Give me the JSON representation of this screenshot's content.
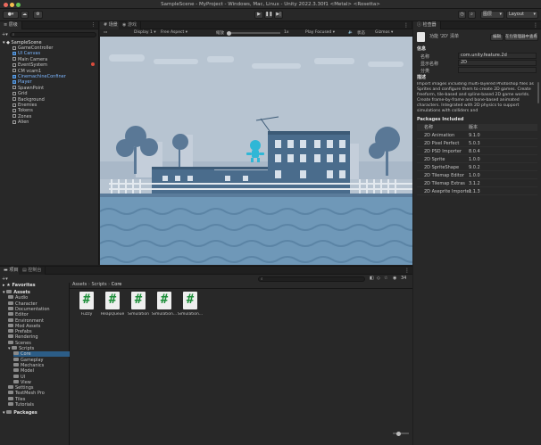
{
  "window": {
    "title": "SampleScene - MyProject - Windows, Mac, Linux - Unity 2022.3.30f1 <Metal> <Rosetta>"
  },
  "toolbar": {
    "layers_label": "图层",
    "layout_label": "Layout"
  },
  "hierarchy": {
    "tab_label": "层级",
    "search_placeholder": "All",
    "scene_name": "SampleScene",
    "items": [
      {
        "label": "GameController"
      },
      {
        "label": "UI Canvas"
      },
      {
        "label": "Main Camera"
      },
      {
        "label": "EventSystem"
      },
      {
        "label": "CM vcam1"
      },
      {
        "label": "CinemachineConfiner"
      },
      {
        "label": "Player"
      },
      {
        "label": "SpawnPoint"
      },
      {
        "label": "Grid"
      },
      {
        "label": "Background"
      },
      {
        "label": "Enemies"
      },
      {
        "label": "Tokens"
      },
      {
        "label": "Zones"
      },
      {
        "label": "Alien"
      }
    ]
  },
  "scene": {
    "tabs": [
      "场景",
      "游戏"
    ],
    "display": "Display 1",
    "aspect": "Free Aspect",
    "scale_label": "缩放",
    "scale_value": "1x",
    "play_mode": "Play Focused",
    "stats": "状态",
    "gizmos": "Gizmos"
  },
  "inspector": {
    "tab_label": "检查器",
    "header": "功能 '2D' 清单",
    "btn_edit": "编辑",
    "btn_open": "在包管理器中查看",
    "info_title": "信息",
    "fields": [
      {
        "label": "名称",
        "value": "com.unity.feature.2d"
      },
      {
        "label": "显示名称",
        "value": "2D"
      },
      {
        "label": "分类",
        "value": ""
      }
    ],
    "desc_title": "描述",
    "description": "Import images including multi-layered Photoshop files as Sprites and configure them to create 2D games. Create freeform, tile-based and spline-based 2D game worlds. Create frame-by-frame and bone-based animated characters. Integrated with 2D physics to support simulations with colliders and",
    "packages_title": "Packages Included",
    "col_name": "名称",
    "col_version": "版本",
    "packages": [
      {
        "name": "2D Animation",
        "version": "9.1.0"
      },
      {
        "name": "2D Pixel Perfect",
        "version": "5.0.3"
      },
      {
        "name": "2D PSD Importer",
        "version": "8.0.4"
      },
      {
        "name": "2D Sprite",
        "version": "1.0.0"
      },
      {
        "name": "2D SpriteShape",
        "version": "9.0.2"
      },
      {
        "name": "2D Tilemap Editor",
        "version": "1.0.0"
      },
      {
        "name": "2D Tilemap Extras",
        "version": "3.1.2"
      },
      {
        "name": "2D Aseprite Importer",
        "version": "1.1.3"
      }
    ]
  },
  "project": {
    "tabs": [
      "项目",
      "控制台"
    ],
    "favorites": "Favorites",
    "breadcrumb": [
      "Assets",
      "Scripts",
      "Core"
    ],
    "count": "34",
    "tree": [
      {
        "label": "Assets",
        "depth": 0
      },
      {
        "label": "Audio",
        "depth": 1
      },
      {
        "label": "Character",
        "depth": 1
      },
      {
        "label": "Documentation",
        "depth": 1
      },
      {
        "label": "Editor",
        "depth": 1
      },
      {
        "label": "Environment",
        "depth": 1
      },
      {
        "label": "Mod Assets",
        "depth": 1
      },
      {
        "label": "Prefabs",
        "depth": 1
      },
      {
        "label": "Rendering",
        "depth": 1
      },
      {
        "label": "Scenes",
        "depth": 1
      },
      {
        "label": "Scripts",
        "depth": 1
      },
      {
        "label": "Core",
        "depth": 2
      },
      {
        "label": "Gameplay",
        "depth": 2
      },
      {
        "label": "Mechanics",
        "depth": 2
      },
      {
        "label": "Model",
        "depth": 2
      },
      {
        "label": "UI",
        "depth": 2
      },
      {
        "label": "View",
        "depth": 2
      },
      {
        "label": "Settings",
        "depth": 1
      },
      {
        "label": "TextMesh Pro",
        "depth": 1
      },
      {
        "label": "Tiles",
        "depth": 1
      },
      {
        "label": "Tutorials",
        "depth": 1
      },
      {
        "label": "Packages",
        "depth": 0
      }
    ],
    "assets": [
      {
        "label": "Fuzzy"
      },
      {
        "label": "HeapQueue"
      },
      {
        "label": "Simulation"
      },
      {
        "label": "Simulation..."
      },
      {
        "label": "Simulation..."
      }
    ]
  },
  "colors": {
    "accent": "#2c5d87",
    "sky": "#b7c4d1",
    "building": "#4a6c8c",
    "water": "#6f98b8",
    "script_hash": "#1e8f3a"
  }
}
